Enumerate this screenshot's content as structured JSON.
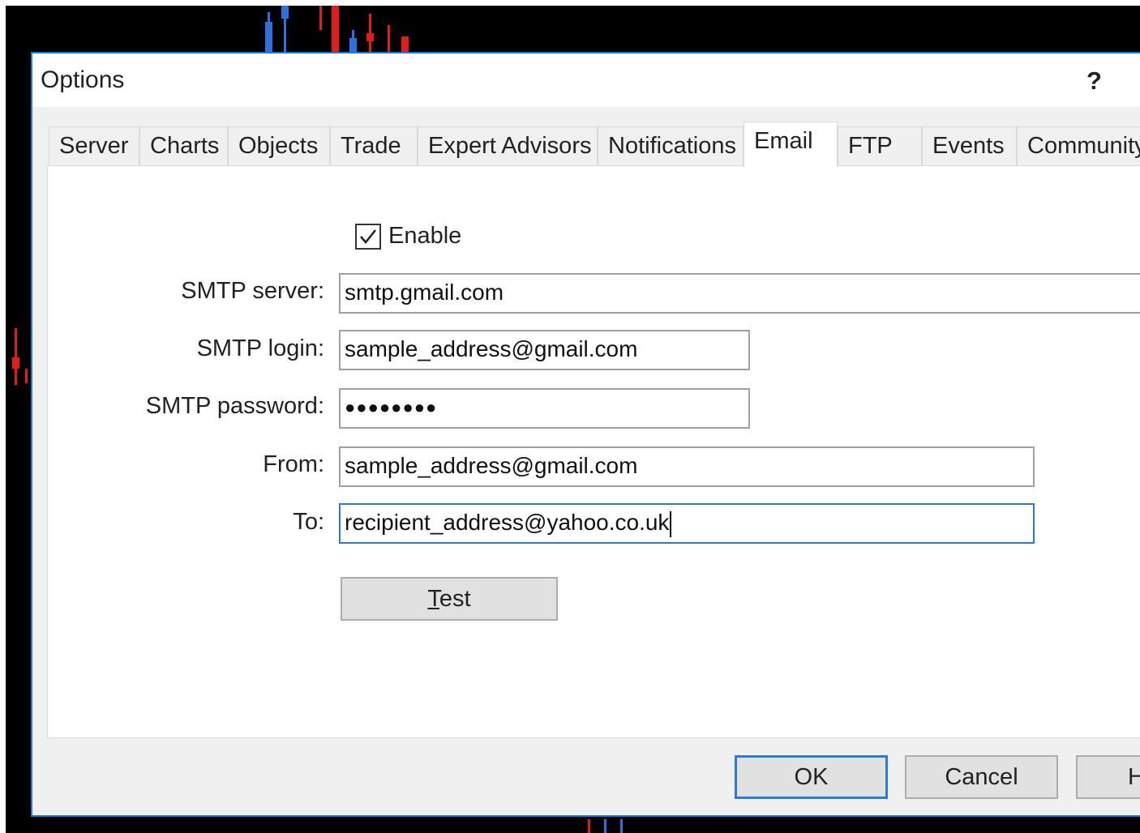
{
  "dialog": {
    "title": "Options",
    "help_label": "?"
  },
  "tabs": [
    {
      "label": "Server"
    },
    {
      "label": "Charts"
    },
    {
      "label": "Objects"
    },
    {
      "label": "Trade"
    },
    {
      "label": "Expert Advisors"
    },
    {
      "label": "Notifications"
    },
    {
      "label": "Email",
      "active": true
    },
    {
      "label": "FTP"
    },
    {
      "label": "Events"
    },
    {
      "label": "Community"
    }
  ],
  "email": {
    "enable_label": "Enable",
    "enable_checked": true,
    "smtp_server_label": "SMTP server:",
    "smtp_server_value": "smtp.gmail.com",
    "smtp_login_label": "SMTP login:",
    "smtp_login_value": "sample_address@gmail.com",
    "smtp_password_label": "SMTP password:",
    "smtp_password_value": "●●●●●●●●",
    "from_label": "From:",
    "from_value": "sample_address@gmail.com",
    "to_label": "To:",
    "to_value": "recipient_address@yahoo.co.uk",
    "test_first": "T",
    "test_rest": "est"
  },
  "buttons": {
    "ok": "OK",
    "cancel": "Cancel",
    "help_partial": "H"
  },
  "colors": {
    "accent": "#2c7ad6",
    "candle_up": "#2f6fe0",
    "candle_down": "#e21b1b"
  }
}
